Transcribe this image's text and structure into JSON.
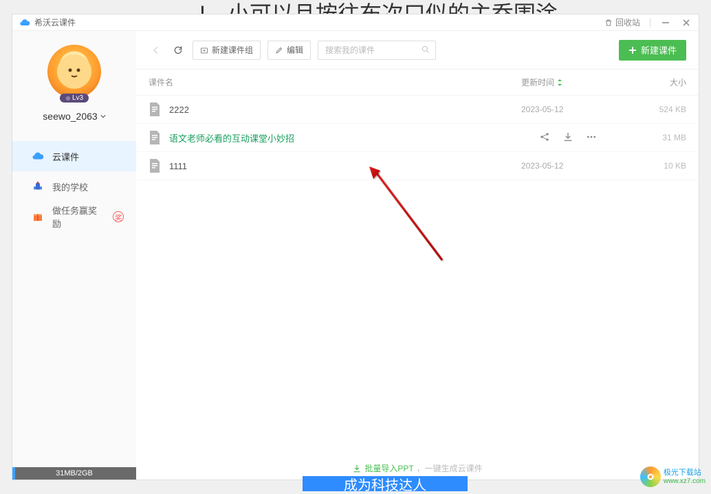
{
  "bg_text_top": "I、小可以且按往布次口似的主乔围涂",
  "app": {
    "title": "希沃云课件"
  },
  "titlebar": {
    "recycle": "回收站"
  },
  "profile": {
    "username": "seewo_2063",
    "level": "Lv3"
  },
  "sidebar": {
    "items": [
      {
        "label": "云课件"
      },
      {
        "label": "我的学校"
      },
      {
        "label": "做任务赢奖励",
        "badge": "奖"
      }
    ],
    "storage": "31MB/2GB"
  },
  "toolbar": {
    "new_group": "新建课件组",
    "edit": "编辑",
    "search_placeholder": "搜索我的课件",
    "new_file": "新建课件"
  },
  "table": {
    "header": {
      "name": "课件名",
      "time": "更新时间",
      "size": "大小"
    },
    "rows": [
      {
        "name": "2222",
        "time": "2023-05-12",
        "size": "524 KB"
      },
      {
        "name": "语文老师必看的互动课堂小妙招",
        "time": "",
        "size": "31 MB"
      },
      {
        "name": "1111",
        "time": "2023-05-12",
        "size": "10 KB"
      }
    ]
  },
  "footer": {
    "import": "批量导入PPT",
    "suffix": "，一键生成云课件"
  },
  "bg_button": "成为科技达人",
  "watermark": {
    "line1": "极光下载站",
    "line2": "www.xz7.com"
  }
}
